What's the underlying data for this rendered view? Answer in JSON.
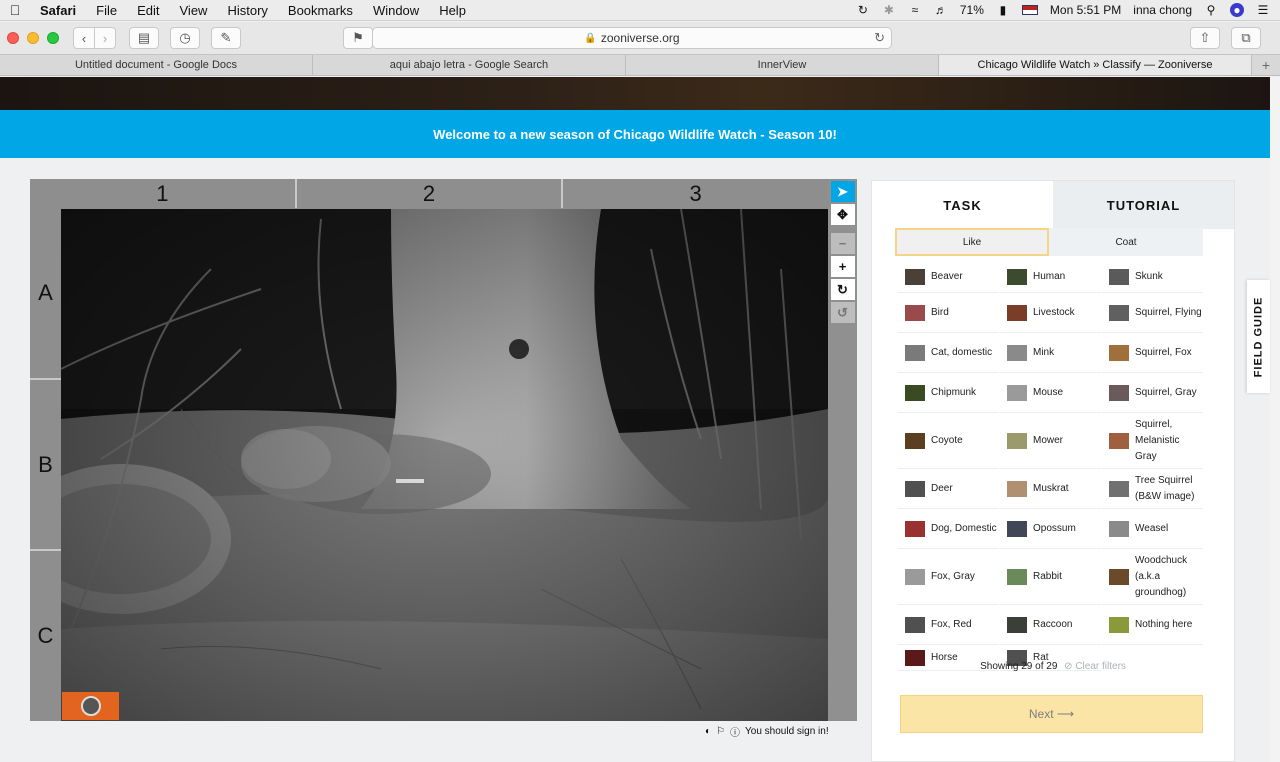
{
  "menubar": {
    "app": "Safari",
    "menus": [
      "File",
      "Edit",
      "View",
      "History",
      "Bookmarks",
      "Window",
      "Help"
    ],
    "battery": "71%",
    "clock": "Mon 5:51 PM",
    "user": "inna chong"
  },
  "toolbar": {
    "address": "zooniverse.org",
    "lock_icon": "lock-icon"
  },
  "tabs": [
    {
      "label": "Untitled document - Google Docs"
    },
    {
      "label": "aqui abajo letra - Google Search"
    },
    {
      "label": "InnerView"
    },
    {
      "label": "Chicago Wildlife Watch » Classify — Zooniverse"
    }
  ],
  "banner": "Welcome to a new season of Chicago Wildlife Watch - Season 10!",
  "viewer": {
    "columns": [
      "1",
      "2",
      "3"
    ],
    "rows": [
      "A",
      "B",
      "C"
    ],
    "sign_in_note": "You should sign in!"
  },
  "panel": {
    "tab_task": "TASK",
    "tab_tutorial": "TUTORIAL",
    "filter_like": "Like",
    "filter_coat": "Coat",
    "choices": [
      {
        "label": "Beaver",
        "color": "#4a4038"
      },
      {
        "label": "Human",
        "color": "#3c4a2e"
      },
      {
        "label": "Skunk",
        "color": "#5a5a5a"
      },
      {
        "label": "Bird",
        "color": "#9a4a4a"
      },
      {
        "label": "Livestock",
        "color": "#7a3e28"
      },
      {
        "label": "Squirrel, Flying",
        "color": "#606060"
      },
      {
        "label": "Cat, domestic",
        "color": "#7a7a7a"
      },
      {
        "label": "Mink",
        "color": "#8a8a8a"
      },
      {
        "label": "Squirrel, Fox",
        "color": "#a0703c"
      },
      {
        "label": "Chipmunk",
        "color": "#3a4a22"
      },
      {
        "label": "Mouse",
        "color": "#9a9a9a"
      },
      {
        "label": "Squirrel, Gray",
        "color": "#6a5a5a"
      },
      {
        "label": "Coyote",
        "color": "#5a4020"
      },
      {
        "label": "Mower",
        "color": "#9a9a6a"
      },
      {
        "label": "Squirrel, Melanistic Gray",
        "color": "#a06040"
      },
      {
        "label": "Deer",
        "color": "#505050"
      },
      {
        "label": "Muskrat",
        "color": "#b09070"
      },
      {
        "label": "Tree Squirrel (B&W image)",
        "color": "#707070"
      },
      {
        "label": "Dog, Domestic",
        "color": "#9a3030"
      },
      {
        "label": "Opossum",
        "color": "#404858"
      },
      {
        "label": "Weasel",
        "color": "#8a8a8a"
      },
      {
        "label": "Fox, Gray",
        "color": "#9a9a9a"
      },
      {
        "label": "Rabbit",
        "color": "#6a8a5a"
      },
      {
        "label": "Woodchuck (a.k.a groundhog)",
        "color": "#6a4a2a"
      },
      {
        "label": "Fox, Red",
        "color": "#505050"
      },
      {
        "label": "Raccoon",
        "color": "#3a4038"
      },
      {
        "label": "Nothing here",
        "color": "#8a9a3a"
      },
      {
        "label": "Horse",
        "color": "#5a1a1a"
      },
      {
        "label": "Rat",
        "color": "#505050"
      }
    ],
    "showing": "Showing 29 of 29",
    "clear_filters": "Clear filters",
    "next": "Next"
  },
  "field_guide": "FIELD GUIDE",
  "colors": {
    "banner": "#00a6e6",
    "next_button": "#fbe5a6",
    "filter_highlight": "#f5d488"
  }
}
